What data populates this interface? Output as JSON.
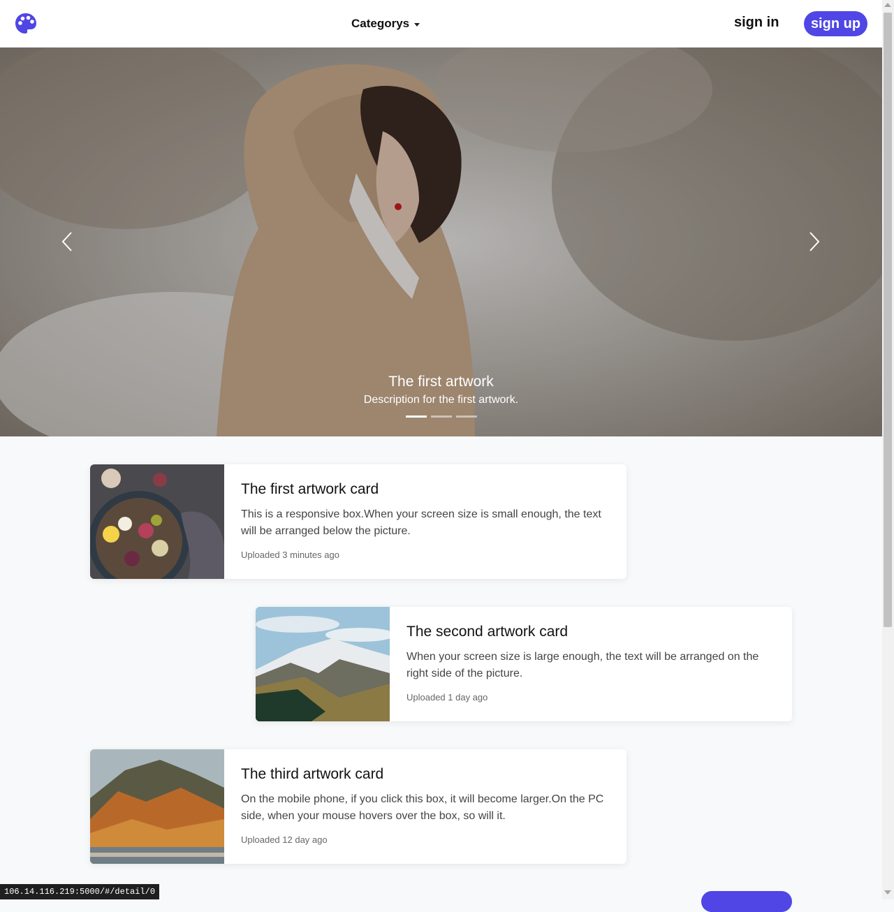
{
  "nav": {
    "menu_label": "Categorys",
    "signin_label": "sign in",
    "signup_label": "sign up",
    "accent_color": "#4f46e5"
  },
  "carousel": {
    "caption_title": "The first artwork",
    "caption_text": "Description for the first artwork.",
    "slide_count": 3,
    "active_index": 0
  },
  "cards": [
    {
      "title": "The first artwork card",
      "text": "This is a responsive box.When your screen size is small enough, the text will be arranged below the picture.",
      "meta": "Uploaded 3 minutes ago"
    },
    {
      "title": "The second artwork card",
      "text": "When your screen size is large enough, the text will be arranged on the right side of the picture.",
      "meta": "Uploaded 1 day ago"
    },
    {
      "title": "The third artwork card",
      "text": "On the mobile phone, if you click this box, it will become larger.On the PC side, when your mouse hovers over the box, so will it.",
      "meta": "Uploaded 12 day ago"
    }
  ],
  "status_bar": {
    "url": "106.14.116.219:5000/#/detail/0"
  }
}
